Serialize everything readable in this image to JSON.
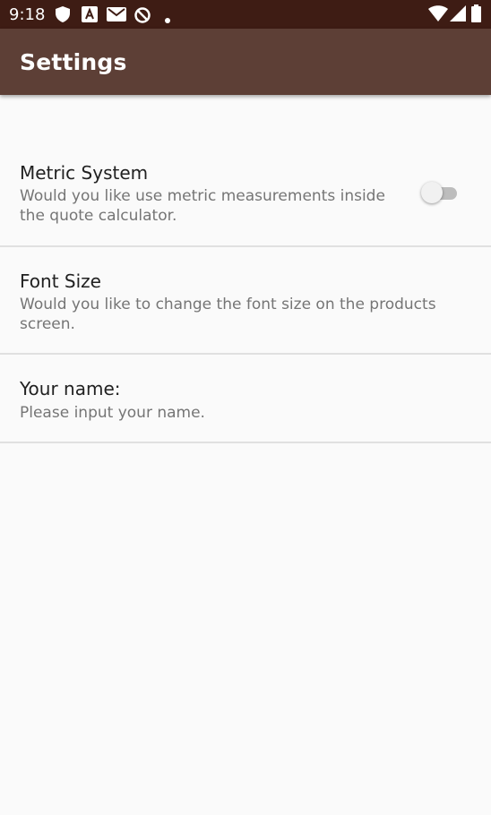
{
  "status_bar": {
    "time": "9:18",
    "icons": [
      "shield-icon",
      "a-notification-icon",
      "gmail-icon",
      "no-sync-icon",
      "dot-icon",
      "wifi-icon",
      "signal-icon",
      "battery-icon"
    ]
  },
  "app_bar": {
    "title": "Settings"
  },
  "preferences": {
    "metric": {
      "title": "Metric System",
      "summary": "Would you like use metric measurements inside the quote calculator.",
      "enabled": false
    },
    "font_size": {
      "title": "Font Size",
      "summary": "Would you like to change the font size on the products screen."
    },
    "name": {
      "title": "Your name:",
      "summary": "Please input your name."
    }
  },
  "colors": {
    "status_bar": "#3e1c14",
    "app_bar": "#5d3f36",
    "background": "#fafafa"
  }
}
